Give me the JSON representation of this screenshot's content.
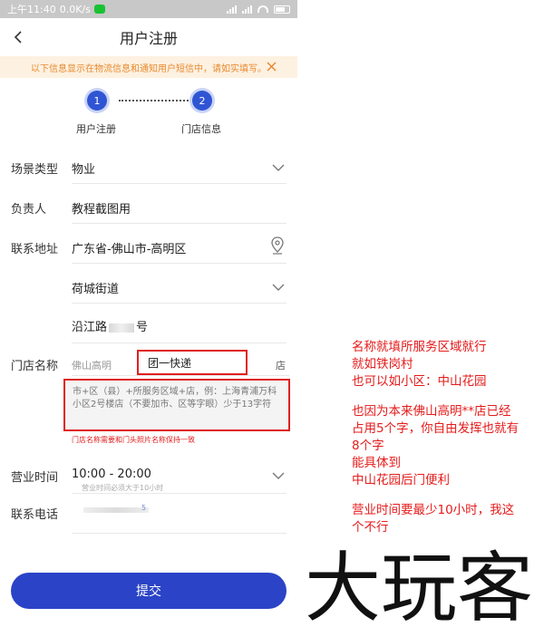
{
  "status_bar": {
    "time": "上午11:40",
    "speed": "0.0K/s"
  },
  "nav": {
    "title": "用户注册"
  },
  "notice": {
    "text": "以下信息显示在物流信息和通知用户短信中，请如实填写。"
  },
  "steps": [
    {
      "number": "1",
      "label": "用户注册"
    },
    {
      "number": "2",
      "label": "门店信息"
    }
  ],
  "form": {
    "scene_type": {
      "label": "场景类型",
      "value": "物业"
    },
    "manager": {
      "label": "负责人",
      "value": "教程截图用"
    },
    "address": {
      "label": "联系地址",
      "region": "广东省-佛山市-高明区",
      "street": "荷城街道",
      "detail_prefix": "沿江路",
      "detail_suffix": "号"
    },
    "store_name": {
      "label": "门店名称",
      "prefix": "佛山高明",
      "value": "团一快递",
      "suffix": "店",
      "hint": "市+区（县）+所服务区域+店，例：上海青浦万科小区2号楼店（不要加市、区等字眼）少于13字符",
      "note": "门店名称需要和门头照片名称保持一致"
    },
    "business_hours": {
      "label": "营业时间",
      "value": "10:00 - 20:00",
      "hint": "营业时间必须大于10小时"
    },
    "phone": {
      "label": "联系电话",
      "suffix": "5"
    }
  },
  "submit_label": "提交",
  "annotation": {
    "para1": [
      "名称就填所服务区域就行",
      "就如铁岗村",
      "也可以如小区：中山花园"
    ],
    "para2": [
      "也因为本来佛山高明**店已经",
      "占用5个字，你自由发挥也就有",
      "8个字",
      "能具体到",
      "中山花园后门便利"
    ],
    "para3": [
      "营业时间要最少10小时，我这",
      "个不行"
    ]
  },
  "watermark": {
    "text": "大玩客"
  },
  "colors": {
    "primary": "#2b43c6",
    "notice_bg": "#fdf1e1",
    "notice_text": "#e88a2f",
    "annotation": "#e51b1b"
  }
}
